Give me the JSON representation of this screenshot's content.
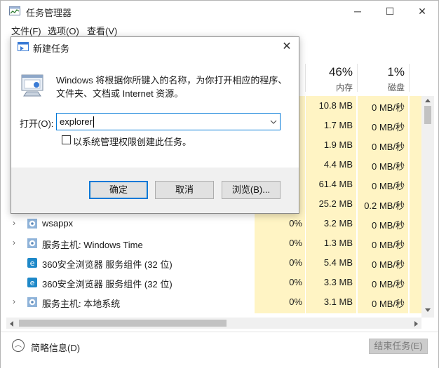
{
  "window": {
    "title": "任务管理器",
    "minimize_glyph": "─",
    "maximize_glyph": "☐",
    "close_glyph": "✕"
  },
  "menu": [
    "文件(F)",
    "选项(O)",
    "查看(V)"
  ],
  "columns": {
    "memory": {
      "percent": "46%",
      "label": "内存"
    },
    "disk": {
      "percent": "1%",
      "label": "磁盘"
    }
  },
  "hidden_rows": [
    {
      "memory": "10.8 MB",
      "disk": "0 MB/秒"
    },
    {
      "memory": "1.7 MB",
      "disk": "0 MB/秒"
    },
    {
      "memory": "1.9 MB",
      "disk": "0 MB/秒"
    },
    {
      "memory": "4.4 MB",
      "disk": "0 MB/秒"
    },
    {
      "memory": "61.4 MB",
      "disk": "0 MB/秒"
    },
    {
      "memory": "25.2 MB",
      "disk": "0.2 MB/秒"
    }
  ],
  "rows": [
    {
      "name": "wsappx",
      "cpu": "0%",
      "memory": "3.2 MB",
      "disk": "0 MB/秒",
      "icon": "gear-icon",
      "expand": "›"
    },
    {
      "name": "服务主机: Windows Time",
      "cpu": "0%",
      "memory": "1.3 MB",
      "disk": "0 MB/秒",
      "icon": "gear-icon",
      "expand": "›"
    },
    {
      "name": "360安全浏览器 服务组件 (32 位)",
      "cpu": "0%",
      "memory": "5.4 MB",
      "disk": "0 MB/秒",
      "icon": "360-browser-icon",
      "expand": ""
    },
    {
      "name": "360安全浏览器 服务组件 (32 位)",
      "cpu": "0%",
      "memory": "3.3 MB",
      "disk": "0 MB/秒",
      "icon": "360-browser-icon",
      "expand": ""
    },
    {
      "name": "服务主机: 本地系统",
      "cpu": "0%",
      "memory": "3.1 MB",
      "disk": "0 MB/秒",
      "icon": "gear-icon",
      "expand": "›"
    }
  ],
  "footer": {
    "fewer_details": "简略信息(D)",
    "end_task": "结束任务(E)"
  },
  "run_dialog": {
    "title": "新建任务",
    "description_line1": "Windows 将根据你所键入的名称，为你打开相应的程序、",
    "description_line2": "文件夹、文档或 Internet 资源。",
    "open_label": "打开(O):",
    "input_value": "explorer",
    "admin_checkbox_label": "以系统管理权限创建此任务。",
    "admin_checked": false,
    "ok_button": "确定",
    "cancel_button": "取消",
    "browse_button": "浏览(B)..."
  },
  "colors": {
    "highlight_column": "#fff4c4",
    "accent": "#0078d7"
  }
}
